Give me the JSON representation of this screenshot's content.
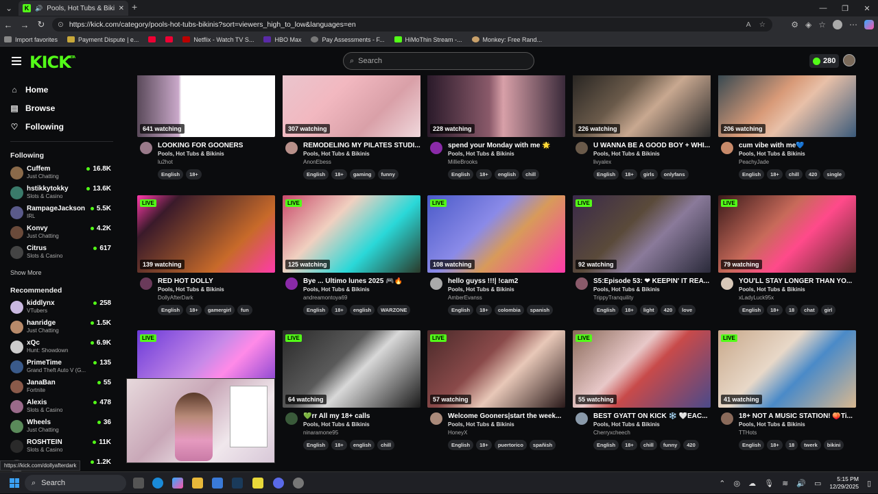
{
  "browser": {
    "tab_title": "Pools, Hot Tubs & Bikinis Str...",
    "url": "https://kick.com/category/pools-hot-tubs-bikinis?sort=viewers_high_to_low&languages=en",
    "bookmarks": [
      "Import favorites",
      "Payment Dispute | e...",
      "Netflix - Watch TV S...",
      "HBO Max",
      "Pay Assessments - F...",
      "HiMoThin Stream -...",
      "Monkey: Free Rand..."
    ],
    "status_url": "https://kick.com/dollyafterdark"
  },
  "header": {
    "logo": "KICK",
    "logo_badge": "BETA",
    "search_placeholder": "Search",
    "coins": "280"
  },
  "nav": {
    "home": "Home",
    "browse": "Browse",
    "following": "Following"
  },
  "sidebar": {
    "following_heading": "Following",
    "show_more": "Show More",
    "recommended_heading": "Recommended",
    "following": [
      {
        "name": "Cuffem",
        "category": "Just Chatting",
        "viewers": "16.8K",
        "color": "#8a6a4a"
      },
      {
        "name": "hstikkytokky",
        "category": "Slots & Casino",
        "viewers": "13.6K",
        "color": "#3a7a6a"
      },
      {
        "name": "RampageJackson",
        "category": "IRL",
        "viewers": "5.5K",
        "color": "#5a5a8a"
      },
      {
        "name": "Konvy",
        "category": "Just Chatting",
        "viewers": "4.2K",
        "color": "#6a4a3a"
      },
      {
        "name": "Citrus",
        "category": "Slots & Casino",
        "viewers": "617",
        "color": "#444"
      }
    ],
    "recommended": [
      {
        "name": "kiddlynx",
        "category": "VTubers",
        "viewers": "258",
        "color": "#c9b8e0"
      },
      {
        "name": "hanridge",
        "category": "Just Chatting",
        "viewers": "1.5K",
        "color": "#b88a6a"
      },
      {
        "name": "xQc",
        "category": "Hunt: Showdown",
        "viewers": "6.9K",
        "color": "#ccc"
      },
      {
        "name": "PrimeTime",
        "category": "Grand Theft Auto V (G...",
        "viewers": "135",
        "color": "#3a5a8a"
      },
      {
        "name": "JanaBan",
        "category": "Fortnite",
        "viewers": "55",
        "color": "#8a5a4a"
      },
      {
        "name": "Alexis",
        "category": "Slots & Casino",
        "viewers": "478",
        "color": "#9a6a8a"
      },
      {
        "name": "Wheels",
        "category": "Just Chatting",
        "viewers": "36",
        "color": "#5a8a5a"
      },
      {
        "name": "ROSHTEIN",
        "category": "Slots & Casino",
        "viewers": "11K",
        "color": "#2a2a2a"
      },
      {
        "name": "",
        "category": "",
        "viewers": "1.2K",
        "color": "#444"
      }
    ]
  },
  "live_label": "LIVE",
  "streams": [
    {
      "watching": "641 watching",
      "live": false,
      "title": "LOOKING FOR GOONERS",
      "category": "Pools, Hot Tubs & Bikinis",
      "user": "lu2hot",
      "tags": [
        "English",
        "18+"
      ],
      "bg": "linear-gradient(90deg,#5a4a5a 0%,#c9a8c9 30%,#fff 32%,#fff 100%)",
      "av": "#9a7a8a"
    },
    {
      "watching": "307 watching",
      "live": false,
      "title": "REMODELING MY PILATES STUDI...",
      "category": "Pools, Hot Tubs & Bikinis",
      "user": "AnonEbess",
      "tags": [
        "English",
        "18+",
        "gaming",
        "funny"
      ],
      "bg": "linear-gradient(135deg,#e8c8d0,#f2b8c0 40%,#d9a0a8 70%,#f0d8dc)",
      "av": "#b8908a"
    },
    {
      "watching": "228 watching",
      "live": false,
      "title": "spend your Monday with me 🌟",
      "category": "Pools, Hot Tubs & Bikinis",
      "user": "MillieBrooks",
      "tags": [
        "English",
        "18+",
        "english",
        "chill"
      ],
      "bg": "linear-gradient(90deg,#2a1a2a,#8a5a6a 45%,#d8a0a8 55%,#3a2a3a)",
      "av": "#8a2aa8"
    },
    {
      "watching": "226 watching",
      "live": false,
      "title": "U WANNA BE A GOOD BOY + WHI...",
      "category": "Pools, Hot Tubs & Bikinis",
      "user": "livyalex",
      "tags": [
        "English",
        "18+",
        "girls",
        "onlyfans"
      ],
      "bg": "linear-gradient(135deg,#1a1a1a,#6a5a4a 40%,#c8a890 60%,#2a2a2a)",
      "av": "#6a5a4a"
    },
    {
      "watching": "206 watching",
      "live": false,
      "title": "cum vibe with me💙",
      "category": "Pools, Hot Tubs & Bikinis",
      "user": "PeachyJade",
      "tags": [
        "English",
        "18+",
        "chill",
        "420",
        "single"
      ],
      "bg": "linear-gradient(135deg,#1a3a4a,#d89a78 45%,#e8c0a8 60%,#3a5a7a)",
      "av": "#c88a6a"
    },
    {
      "watching": "139 watching",
      "live": true,
      "title": "RED HOT DOLLY",
      "category": "Pools, Hot Tubs & Bikinis",
      "user": "DollyAfterDark",
      "tags": [
        "English",
        "18+",
        "gamergirl",
        "fun"
      ],
      "bg": "linear-gradient(135deg,#ff3aaa,#3a1a2a 20%,#8a4a2a 50%,#c86a2a 70%,#ff3aaa)",
      "av": "#6a3a5a"
    },
    {
      "watching": "125 watching",
      "live": true,
      "title": "Bye ... Último lunes 2025 🎮🔥",
      "category": "Pools, Hot Tubs & Bikinis",
      "user": "andreamontoya69",
      "tags": [
        "English",
        "18+",
        "english",
        "WARZONE"
      ],
      "bg": "linear-gradient(135deg,#c84a6a,#f0d0c0 35%,#2ad8d8 65%,#2a3a2a)",
      "av": "#8a2aa8"
    },
    {
      "watching": "108 watching",
      "live": true,
      "title": "hello guyss !!!| !cam2",
      "category": "Pools, Hot Tubs & Bikinis",
      "user": "AmberEvanss",
      "tags": [
        "English",
        "18+",
        "colombia",
        "spanish"
      ],
      "bg": "linear-gradient(135deg,#4a5ac8,#8a8ae8 40%,#d89a5a 60%,#ff3aaa)",
      "av": "#aaa"
    },
    {
      "watching": "92 watching",
      "live": true,
      "title": "S5:Episode 53: ❤ KEEPIN' IT REA...",
      "category": "Pools, Hot Tubs & Bikinis",
      "user": "TrippyTranquility",
      "tags": [
        "English",
        "18+",
        "light",
        "420",
        "love"
      ],
      "bg": "linear-gradient(135deg,#3a2a4a,#5a4a3a 40%,#8a7a9a 60%,#2a2a3a)",
      "av": "#8a5a6a"
    },
    {
      "watching": "79 watching",
      "live": true,
      "title": "YOU'LL STAY LONGER THAN YO...",
      "category": "Pools, Hot Tubs & Bikinis",
      "user": "xLadyLuck95x",
      "tags": [
        "English",
        "18+",
        "18",
        "chat",
        "girl"
      ],
      "bg": "linear-gradient(135deg,#3a1a1a,#c86a5a 40%,#ff4a8a 60%,#5a2a2a)",
      "av": "#d8c8b8"
    },
    {
      "watching": "",
      "live": true,
      "title": "",
      "category": "",
      "user": "",
      "tags": [],
      "bg": "linear-gradient(135deg,#6a3ad8,#c88ae8 45%,#ff8ae8 60%,#5a2ac8)",
      "av": "#7a5a8a"
    },
    {
      "watching": "64 watching",
      "live": true,
      "title": "💚rr All my 18+ calls",
      "category": "Pools, Hot Tubs & Bikinis",
      "user": "ninaramone95",
      "tags": [
        "English",
        "18+",
        "english",
        "chill"
      ],
      "bg": "linear-gradient(135deg,#2a2a2a,#5a5a5a 40%,#d8d8d8 55%,#1a1a1a)",
      "av": "#3a5a3a"
    },
    {
      "watching": "57 watching",
      "live": true,
      "title": "Welcome Gooners|start the week...",
      "category": "Pools, Hot Tubs & Bikinis",
      "user": "HoneyX",
      "tags": [
        "English",
        "18+",
        "puertorico",
        "spañish"
      ],
      "bg": "linear-gradient(135deg,#4a2a2a,#8a4a4a 40%,#e8c8b8 60%,#2a1a1a)",
      "av": "#aa8a7a"
    },
    {
      "watching": "55 watching",
      "live": true,
      "title": "BEST GYATT ON KICK ❄️ 🤍EAC...",
      "category": "Pools, Hot Tubs & Bikinis",
      "user": "Cherryxcheech",
      "tags": [
        "English",
        "18+",
        "chill",
        "funny",
        "420"
      ],
      "bg": "linear-gradient(135deg,#8a6a5a,#e8c8c8 40%,#c84a4a 55%,#4a4a8a)",
      "av": "#8a9aaa"
    },
    {
      "watching": "41 watching",
      "live": true,
      "title": "18+ NOT A MUSIC STATION! 🍑Ti...",
      "category": "Pools, Hot Tubs & Bikinis",
      "user": "TTHots",
      "tags": [
        "English",
        "18+",
        "18",
        "twerk",
        "bikini"
      ],
      "bg": "linear-gradient(135deg,#c8a88a,#e8d8c8 40%,#4a8ac8 60%,#d8b890)",
      "av": "#8a6a5a"
    }
  ],
  "taskbar": {
    "search": "Search",
    "time": "5:15 PM",
    "date": "12/29/2025"
  }
}
